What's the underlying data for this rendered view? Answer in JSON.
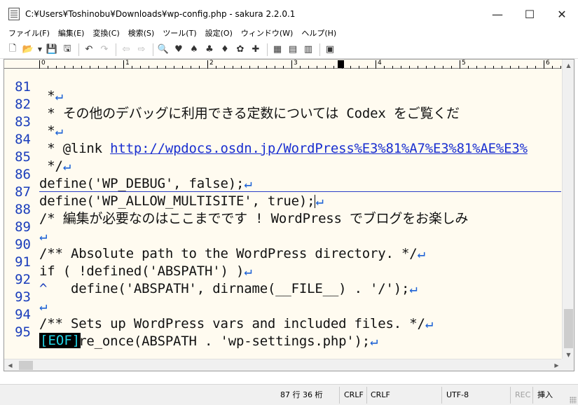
{
  "window": {
    "title": "C:¥Users¥Toshinobu¥Downloads¥wp-config.php - sakura 2.2.0.1",
    "minimize": "—",
    "maximize": "☐",
    "close": "✕"
  },
  "menu": {
    "items": [
      "ファイル(F)",
      "編集(E)",
      "変換(C)",
      "検索(S)",
      "ツール(T)",
      "設定(O)",
      "ウィンドウ(W)",
      "ヘルプ(H)"
    ]
  },
  "toolbar": {
    "icons": [
      "new-file-icon",
      "open-folder-icon",
      "dropdown-icon",
      "save-icon",
      "save-all-icon",
      "undo-icon",
      "redo-icon",
      "jump-back-icon",
      "jump-forward-icon",
      "search-icon",
      "search-prev-icon",
      "search-next-icon",
      "replace-icon",
      "mark-icon",
      "grep-icon",
      "tag-jump-icon",
      "outline-icon",
      "settings-icon",
      "type-settings-icon",
      "font-icon",
      "window-list-icon"
    ]
  },
  "ruler": {
    "labels": [
      "0",
      "1",
      "2",
      "3",
      "4",
      "5",
      "6"
    ]
  },
  "editor": {
    "lines": [
      {
        "num": "81",
        "text": " *",
        "crlf": "↵"
      },
      {
        "num": "82",
        "text": " * その他のデバッグに利用できる定数については Codex をご覧くだ",
        "crlf": ""
      },
      {
        "num": "83",
        "text": " *",
        "crlf": "↵"
      },
      {
        "num": "84",
        "text": " * @link ",
        "link": "http://wpdocs.osdn.jp/WordPress%E3%81%A7%E3%81%AE%E3%",
        "crlf": ""
      },
      {
        "num": "85",
        "text": " */",
        "crlf": "↵"
      },
      {
        "num": "86",
        "text": "define('WP_DEBUG', false);",
        "crlf": "↵"
      },
      {
        "num": "87",
        "text": "define('WP_ALLOW_MULTISITE', true);",
        "crlf": "↵"
      },
      {
        "num": "88",
        "text": "/* 編集が必要なのはここまでです ! WordPress でブログをお楽しみ",
        "crlf": ""
      },
      {
        "num": "89",
        "text": "",
        "crlf": "↵"
      },
      {
        "num": "90",
        "text": "/** Absolute path to the WordPress directory. */",
        "crlf": "↵"
      },
      {
        "num": "91",
        "text": "if ( !defined('ABSPATH') )",
        "crlf": "↵"
      },
      {
        "num": "92",
        "tab": "^",
        "text": "   define('ABSPATH', dirname(__FILE__) . '/');",
        "crlf": "↵"
      },
      {
        "num": "93",
        "text": "",
        "crlf": "↵"
      },
      {
        "num": "94",
        "text": "/** Sets up WordPress vars and included files. */",
        "crlf": "↵"
      },
      {
        "num": "95",
        "text": "require_once(ABSPATH . 'wp-settings.php');",
        "crlf": "↵"
      }
    ],
    "eof": "[EOF]"
  },
  "status": {
    "position": "87 行  36 桁",
    "newline1": "CRLF",
    "newline2": "CRLF",
    "encoding": "UTF-8",
    "rec": "REC",
    "mode": "挿入"
  },
  "colors": {
    "editor_bg": "#fffbf0",
    "line_number": "#1a3dbb",
    "newline_mark": "#1d62d6",
    "link": "#1a2fd0",
    "eof_bg": "#000000",
    "eof_fg": "#22d6e8"
  }
}
